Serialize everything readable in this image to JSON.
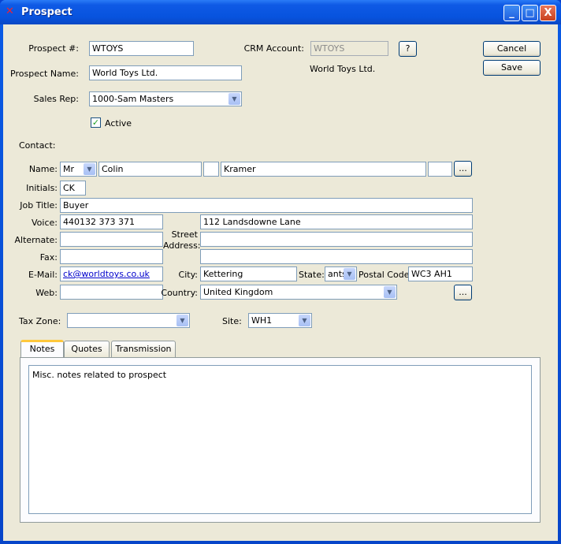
{
  "window": {
    "title": "Prospect",
    "minimize": "_",
    "maximize": "□",
    "close": "X"
  },
  "header": {
    "prospect_number_label": "Prospect #:",
    "prospect_number": "WTOYS",
    "prospect_name_label": "Prospect Name:",
    "prospect_name": "World Toys Ltd.",
    "sales_rep_label": "Sales Rep:",
    "sales_rep": "1000-Sam Masters",
    "active_label": "Active",
    "active": true,
    "crm_account_label": "CRM Account:",
    "crm_account": "WTOYS",
    "crm_help": "?",
    "crm_account_name": "World Toys Ltd.",
    "cancel": "Cancel",
    "save": "Save"
  },
  "contact": {
    "label": "Contact:",
    "name_label": "Name:",
    "honorific": "Mr",
    "first": "Colin",
    "middle": "",
    "last": "Kramer",
    "suffix": "",
    "more": "...",
    "initials_label": "Initials:",
    "initials": "CK",
    "job_title_label": "Job Title:",
    "job_title": "Buyer",
    "voice_label": "Voice:",
    "voice": "440132 373 371",
    "alternate_label": "Alternate:",
    "alternate": "",
    "fax_label": "Fax:",
    "fax": "",
    "email_label": "E-Mail:",
    "email": "ck@worldtoys.co.uk",
    "web_label": "Web:",
    "web": "",
    "street_label": "Street Address:",
    "street1": "112 Landsdowne Lane",
    "street2": "",
    "street3": "",
    "city_label": "City:",
    "city": "Kettering",
    "state_label": "State:",
    "state": "ants",
    "postal_label": "Postal Code:",
    "postal": "WC3 AH1",
    "country_label": "Country:",
    "country": "United Kingdom",
    "address_more": "..."
  },
  "tax_zone_label": "Tax Zone:",
  "tax_zone": "",
  "site_label": "Site:",
  "site": "WH1",
  "tabs": [
    {
      "label": "Notes"
    },
    {
      "label": "Quotes"
    },
    {
      "label": "Transmission"
    }
  ],
  "notes": "Misc. notes related to prospect"
}
